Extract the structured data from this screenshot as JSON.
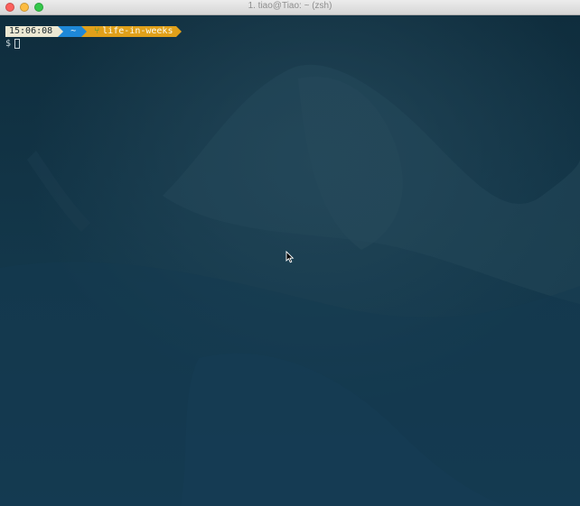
{
  "window": {
    "title": "1. tiao@Tiao: ~ (zsh)"
  },
  "prompt": {
    "time": "15:06:08",
    "directory": "~",
    "git_icon": "git-branch-icon",
    "branch": "life-in-weeks",
    "symbol": "$"
  },
  "colors": {
    "background": "#0f3042",
    "time_segment": "#ece8d3",
    "directory_segment": "#1e88d8",
    "git_segment": "#e0a01a"
  }
}
